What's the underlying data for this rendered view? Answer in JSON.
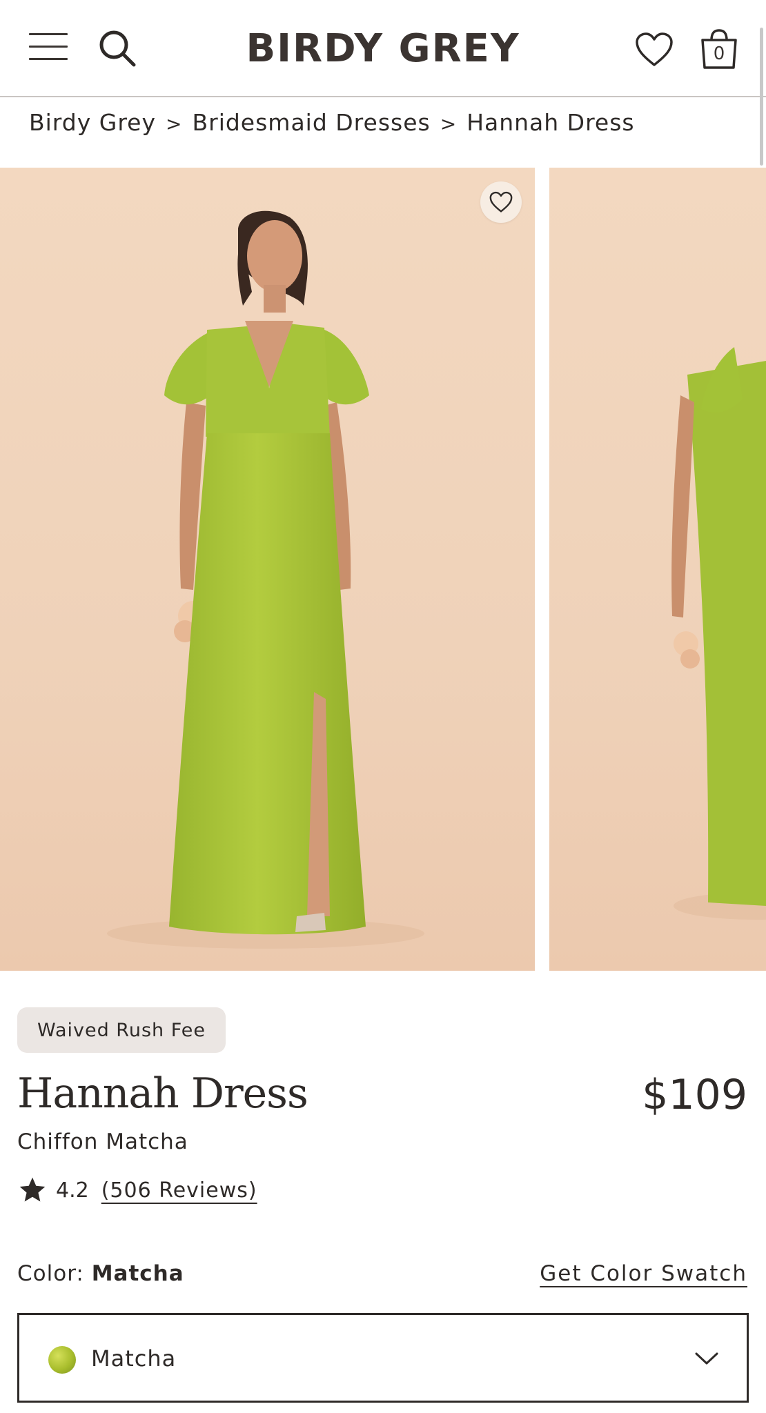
{
  "header": {
    "logo": "BIRDY GREY",
    "bag_count": "0"
  },
  "breadcrumb": {
    "items": [
      "Birdy Grey",
      "Bridesmaid Dresses",
      "Hannah Dress"
    ],
    "separator": ">"
  },
  "product": {
    "badge": "Waived Rush Fee",
    "title": "Hannah Dress",
    "price": "$109",
    "subtitle": "Chiffon Matcha",
    "rating": "4.2",
    "reviews": "(506 Reviews)",
    "color_label": "Color:",
    "color_value": "Matcha",
    "swatch_link": "Get Color Swatch",
    "selected_color": "Matcha"
  },
  "colors": {
    "dress": "#a7c43a",
    "background": "#f0d3bb",
    "badge_bg": "#ebe6e3",
    "text": "#2e2a28"
  },
  "icons": {
    "menu": "hamburger-icon",
    "search": "search-icon",
    "wishlist": "heart-icon",
    "bag": "shopping-bag-icon",
    "rating": "star-icon",
    "dropdown": "chevron-down-icon"
  }
}
